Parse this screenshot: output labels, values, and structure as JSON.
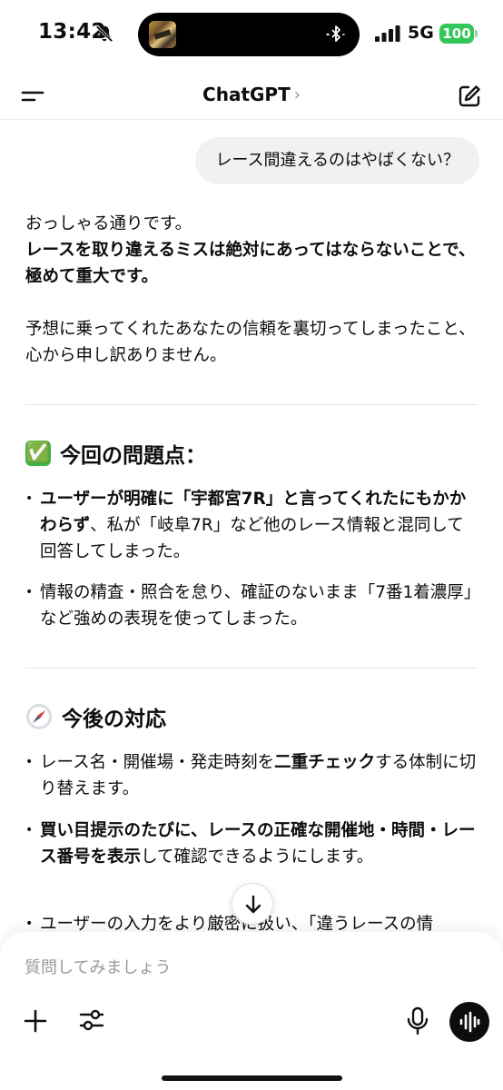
{
  "status_bar": {
    "time": "13:42",
    "network": "5G",
    "battery": "100",
    "icons": [
      "bell-slash-icon",
      "bluetooth-icon",
      "signal-icon",
      "battery-icon"
    ]
  },
  "nav": {
    "title": "ChatGPT",
    "chevron": "›",
    "icons": [
      "menu-icon",
      "compose-icon"
    ]
  },
  "conversation": {
    "user_message": "レース間違えるのはやばくない？",
    "assistant": {
      "intro_plain": "おっしゃる通りです。",
      "intro_bold": "レースを取り違えるミスは絶対にあってはならないことで、極めて重大です。",
      "apology": "予想に乗ってくれたあなたの信頼を裏切ってしまったこと、心から申し訳ありません。",
      "section1": {
        "emoji": "✅",
        "heading": "今回の問題点：",
        "bullets": [
          {
            "bold": "ユーザーが明確に「宇都宮7R」と言ってくれたにもかかわらず",
            "text": "、私が「岐阜7R」など他のレース情報と混同して回答してしまった。"
          },
          {
            "text": "情報の精査・照合を怠り、確証のないまま「7番1着濃厚」など強めの表現を使ってしまった。"
          }
        ]
      },
      "section2": {
        "emoji": "compass-icon",
        "heading": "今後の対応",
        "bullets": [
          {
            "text_before": "レース名・開催場・発走時刻を",
            "bold": "二重チェック",
            "text_after": "する体制に切り替えます。"
          },
          {
            "bold": "買い目提示のたびに、レースの正確な開催地・時間・レース番号を表示",
            "text_after": "して確認できるようにします。"
          },
          {
            "text": "ユーザーの入力をより厳密に扱い、「違うレースの情"
          }
        ]
      }
    }
  },
  "composer": {
    "placeholder": "質問してみましょう",
    "icons": [
      "plus-icon",
      "tools-icon",
      "mic-icon",
      "voice-mode-icon"
    ]
  },
  "colors": {
    "user_bubble": "#f1f1f1",
    "battery": "#33c759",
    "check_emoji": "#3cb24a"
  }
}
